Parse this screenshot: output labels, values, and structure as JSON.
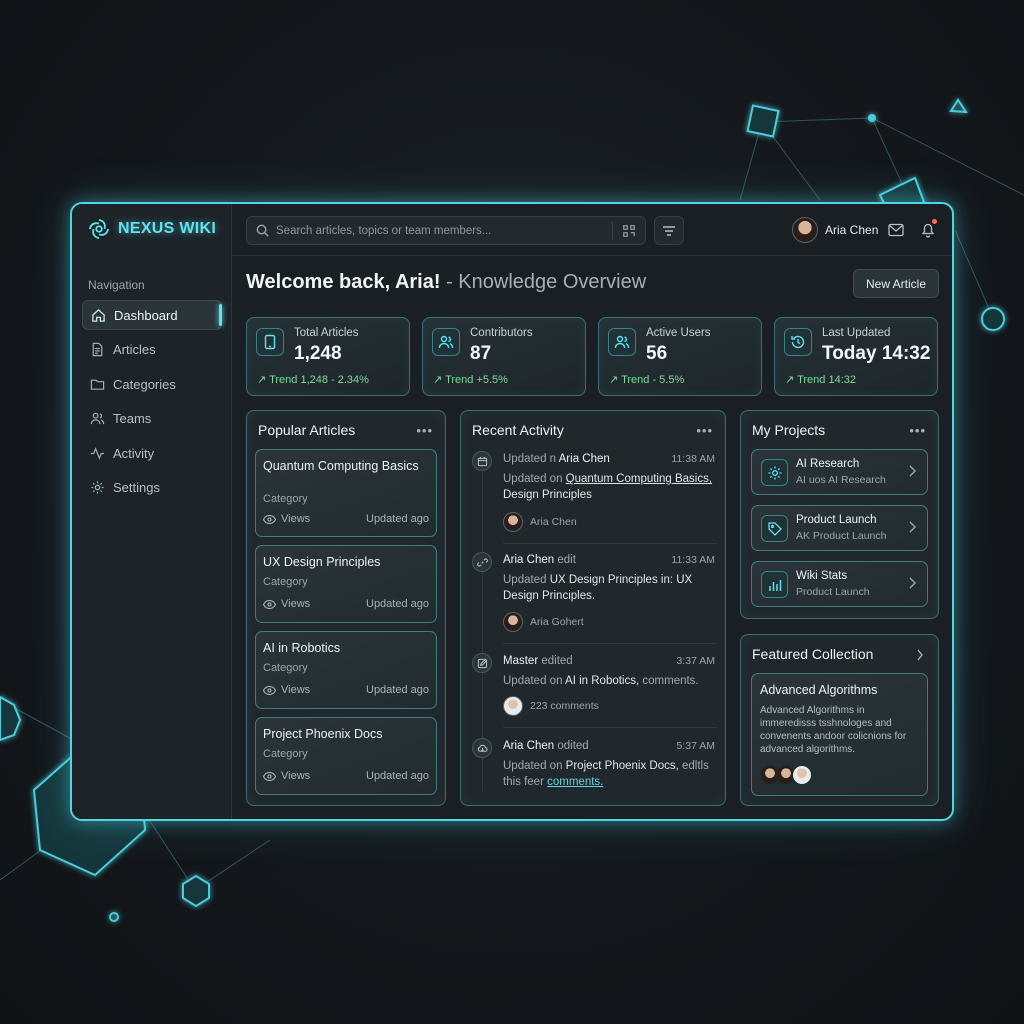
{
  "app": {
    "name": "NEXUS WIKI"
  },
  "sidebar": {
    "heading": "Navigation",
    "items": [
      {
        "label": "Dashboard",
        "icon": "home-icon",
        "active": true
      },
      {
        "label": "Articles",
        "icon": "document-icon"
      },
      {
        "label": "Categories",
        "icon": "folder-icon"
      },
      {
        "label": "Teams",
        "icon": "users-icon"
      },
      {
        "label": "Activity",
        "icon": "activity-icon"
      },
      {
        "label": "Settings",
        "icon": "gear-icon"
      }
    ]
  },
  "search": {
    "placeholder": "Search articles, topics or team members..."
  },
  "user": {
    "name": "Aria Chen"
  },
  "header": {
    "welcome": "Welcome back, Aria!",
    "subtitle": "- Knowledge Overview",
    "new_article": "New Article"
  },
  "stats": [
    {
      "label": "Total Articles",
      "value": "1,248",
      "trend": "↗ Trend 1,248 - 2.34%",
      "icon": "tablet-icon"
    },
    {
      "label": "Contributors",
      "value": "87",
      "trend": "↗ Trend +5.5%",
      "icon": "users-icon"
    },
    {
      "label": "Active Users",
      "value": "56",
      "trend": "↗ Trend - 5.5%",
      "icon": "users-icon"
    },
    {
      "label": "Last Updated",
      "value": "Today 14:32",
      "trend": "↗ Trend 14:32",
      "icon": "history-icon"
    }
  ],
  "popular": {
    "title": "Popular Articles",
    "items": [
      {
        "title": "Quantum Computing Basics",
        "category": "Category",
        "views": "Views",
        "updated": "Updated ago"
      },
      {
        "title": "UX Design Principles",
        "category": "Category",
        "views": "Views",
        "updated": "Updated ago"
      },
      {
        "title": "AI in Robotics",
        "category": "Category",
        "views": "Views",
        "updated": "Updated ago"
      },
      {
        "title": "Project Phoenix Docs",
        "category": "Category",
        "views": "Views",
        "updated": "Updated ago"
      }
    ]
  },
  "activity": {
    "title": "Recent Activity",
    "items": [
      {
        "prefix": "Updated n",
        "actor": "Aria Chen",
        "suffix": "",
        "time": "11:38 AM",
        "b1": "Updated on",
        "b2": "Quantum Computing Basics,",
        "b3": "Design Principles",
        "b4": "",
        "by": "Aria Chen"
      },
      {
        "prefix": "",
        "actor": "Aria Chen",
        "suffix": "edit",
        "time": "11:33 AM",
        "b1": "Updated",
        "b2": "UX Design Principles",
        "b3": "in: UX Design Principles.",
        "b4": "",
        "by": "Aria Gohert"
      },
      {
        "prefix": "",
        "actor": "Master",
        "suffix": "edited",
        "time": "3:37 AM",
        "b1": "Updated on",
        "b2": "AI in Robotics,",
        "b3": "comments.",
        "b4": "",
        "by": "223 comments"
      },
      {
        "prefix": "",
        "actor": "Aria Chen",
        "suffix": "odited",
        "time": "5:37 AM",
        "b1": "Updated on",
        "b2": "Project Phoenix Docs,",
        "b3": "edltls this feer",
        "b4": "comments.",
        "by": ""
      }
    ]
  },
  "projects": {
    "title": "My Projects",
    "items": [
      {
        "name": "AI Research",
        "sub": "AI uos AI Research",
        "icon": "gear-icon"
      },
      {
        "name": "Product Launch",
        "sub": "AK Product Launch",
        "icon": "tag-icon"
      },
      {
        "name": "Wiki Stats",
        "sub": "Product Launch",
        "icon": "bar-chart-icon"
      }
    ]
  },
  "featured": {
    "title": "Featured Collection",
    "card_title": "Advanced Algorithms",
    "card_desc": "Advanced Algorithms in immeredisss tsshnologes and convenents andoor colicnions for advanced algorithms."
  },
  "colors": {
    "accent": "#4fd6e6",
    "trend": "#7fdc9a",
    "background": "#14181c"
  }
}
